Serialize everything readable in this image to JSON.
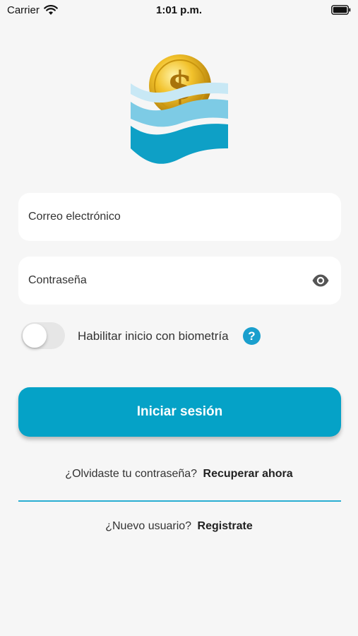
{
  "status_bar": {
    "carrier": "Carrier",
    "time": "1:01 p.m."
  },
  "login": {
    "email_placeholder": "Correo electrónico",
    "password_placeholder": "Contraseña",
    "biometric_label": "Habilitar inicio con biometría",
    "biometric_enabled": false,
    "help_symbol": "?",
    "submit_label": "Iniciar sesión"
  },
  "forgot": {
    "question": "¿Olvidaste tu contraseña?",
    "link": "Recuperar ahora"
  },
  "register": {
    "question": "¿Nuevo usuario?",
    "link": "Registrate"
  },
  "icons": {
    "wifi": "wifi-icon",
    "battery": "battery-icon",
    "logo": "coin-waves-logo",
    "eye": "eye-icon",
    "help": "help-icon"
  },
  "colors": {
    "accent": "#05a2c7",
    "help": "#1a9fcd",
    "divider": "#2aaed2",
    "background": "#f6f6f6"
  }
}
